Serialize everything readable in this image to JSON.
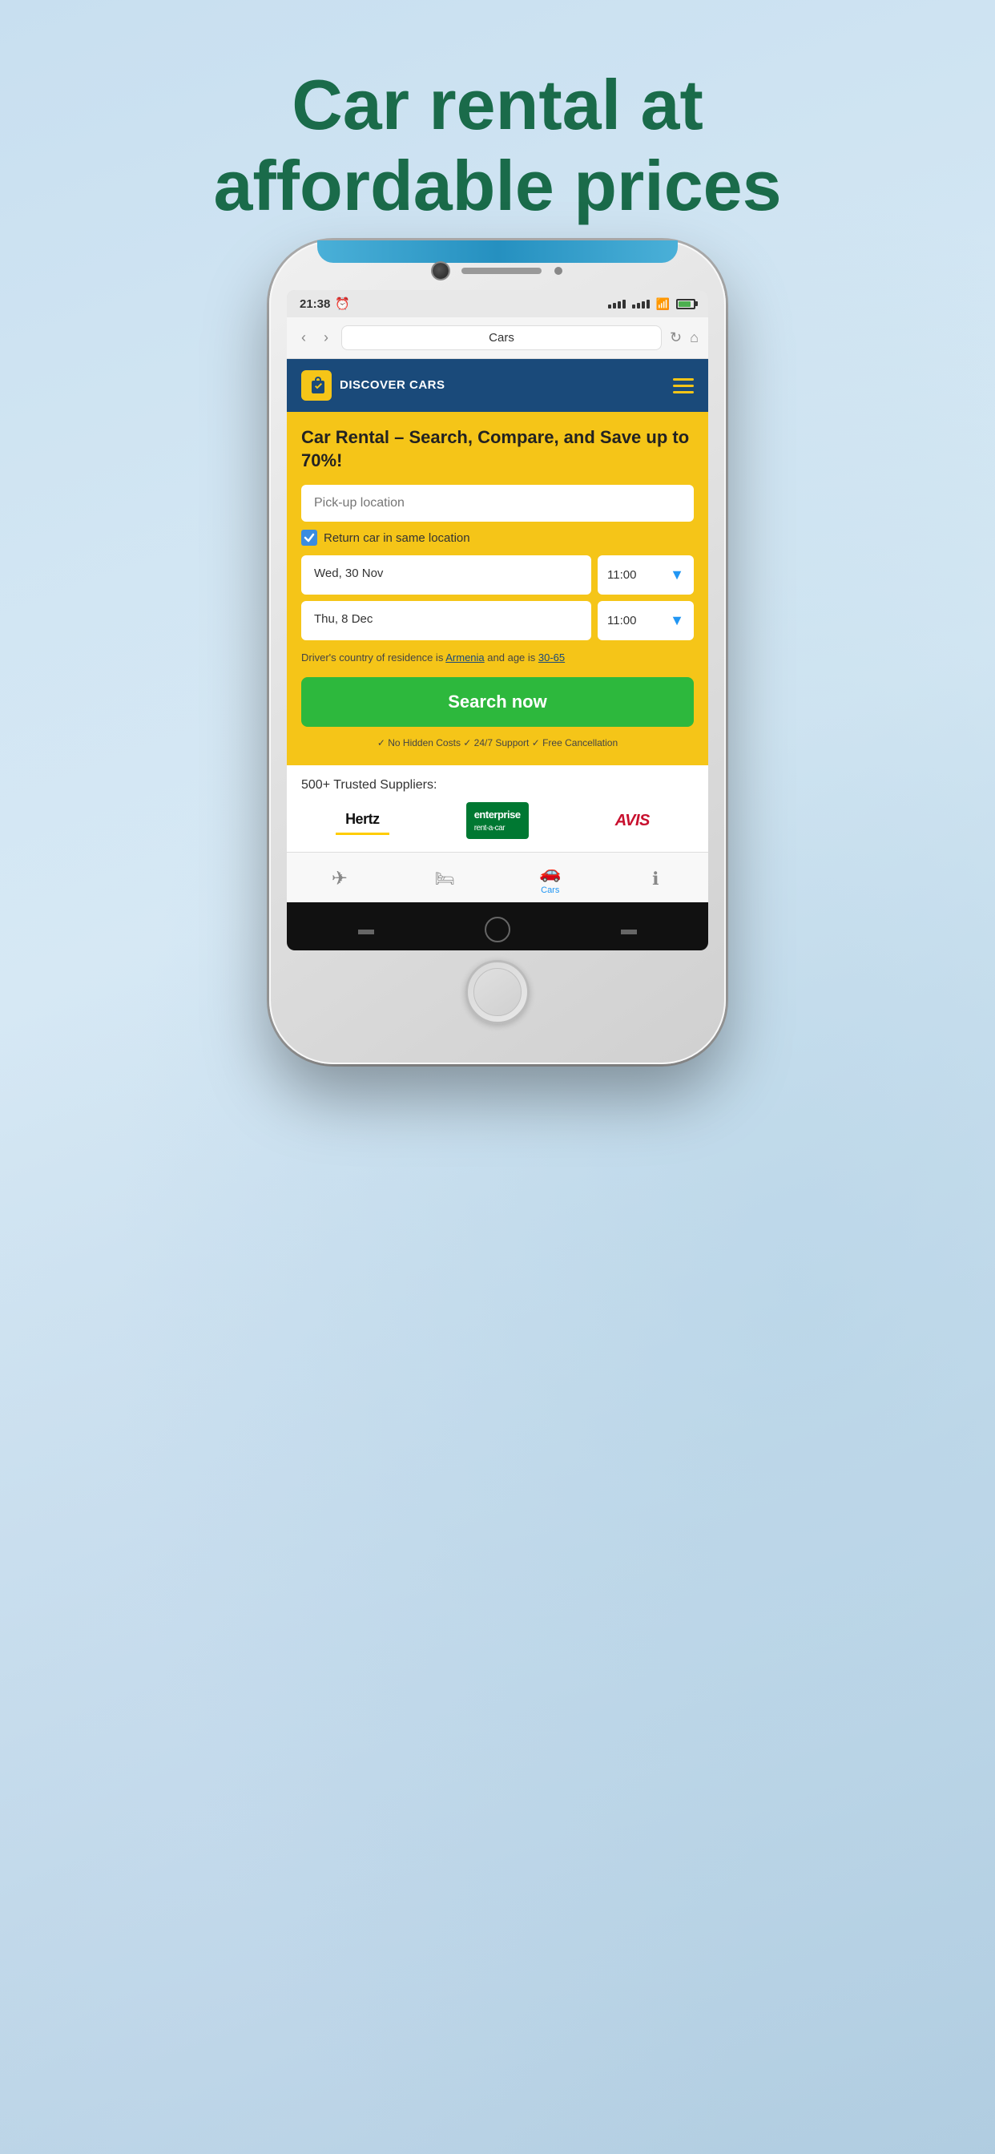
{
  "page": {
    "title": "Car rental at\naffordable prices",
    "background_color": "#c8dff0"
  },
  "phone": {
    "status_bar": {
      "time": "21:38",
      "signal": "signal",
      "wifi": "wifi",
      "battery": "battery"
    },
    "browser": {
      "back_label": "‹",
      "forward_label": "›",
      "url_title": "Cars",
      "refresh_label": "↻",
      "home_label": "⌂"
    },
    "app": {
      "logo_name": "DISCOVER\nCARS",
      "menu_label": "☰",
      "hero_title": "Car Rental – Search, Compare, and Save up to 70%!",
      "pickup_placeholder": "Pick-up location",
      "return_same_label": "Return car in same location",
      "pickup_date": "Wed, 30 Nov",
      "pickup_time": "11:00",
      "return_date": "Thu, 8 Dec",
      "return_time": "11:00",
      "driver_info_text": "Driver's country of residence is",
      "driver_country": "Armenia",
      "driver_info_and": "and age is",
      "driver_age": "30-65",
      "search_button": "Search now",
      "trust_text": "✓ No Hidden Costs ✓ 24/7 Support ✓ Free Cancellation",
      "suppliers_title": "500+ Trusted Suppliers:",
      "suppliers": [
        {
          "name": "Hertz",
          "type": "hertz"
        },
        {
          "name": "enterprise",
          "type": "enterprise"
        },
        {
          "name": "AVIS",
          "type": "avis"
        }
      ],
      "nav_items": [
        {
          "icon": "✈",
          "label": "",
          "active": false
        },
        {
          "icon": "🛏",
          "label": "",
          "active": false
        },
        {
          "icon": "🚗",
          "label": "Cars",
          "active": true
        },
        {
          "icon": "ℹ",
          "label": "",
          "active": false
        }
      ]
    }
  }
}
